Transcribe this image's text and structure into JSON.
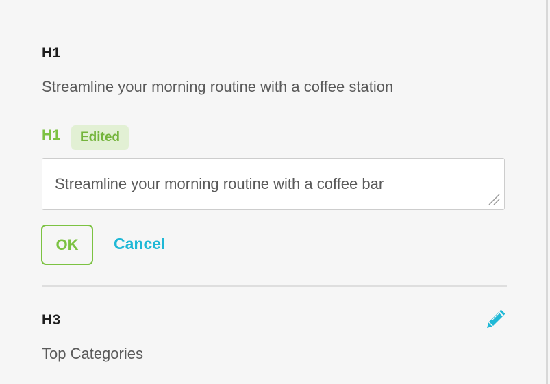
{
  "sections": {
    "original": {
      "tag": "H1",
      "text": "Streamline your morning routine with a coffee station"
    },
    "editing": {
      "tag": "H1",
      "badge": "Edited",
      "input_value": "Streamline your morning routine with a coffee bar"
    },
    "actions": {
      "ok_label": "OK",
      "cancel_label": "Cancel"
    },
    "next": {
      "tag": "H3",
      "text": "Top Categories",
      "edit_icon": "pencil-icon"
    }
  },
  "colors": {
    "accent_green": "#7cc242",
    "badge_bg": "#e2f0d4",
    "link_blue": "#1fb8d6",
    "text_dark": "#1e1e1e",
    "text_muted": "#5a5a5a",
    "background": "#f6f6f6"
  }
}
